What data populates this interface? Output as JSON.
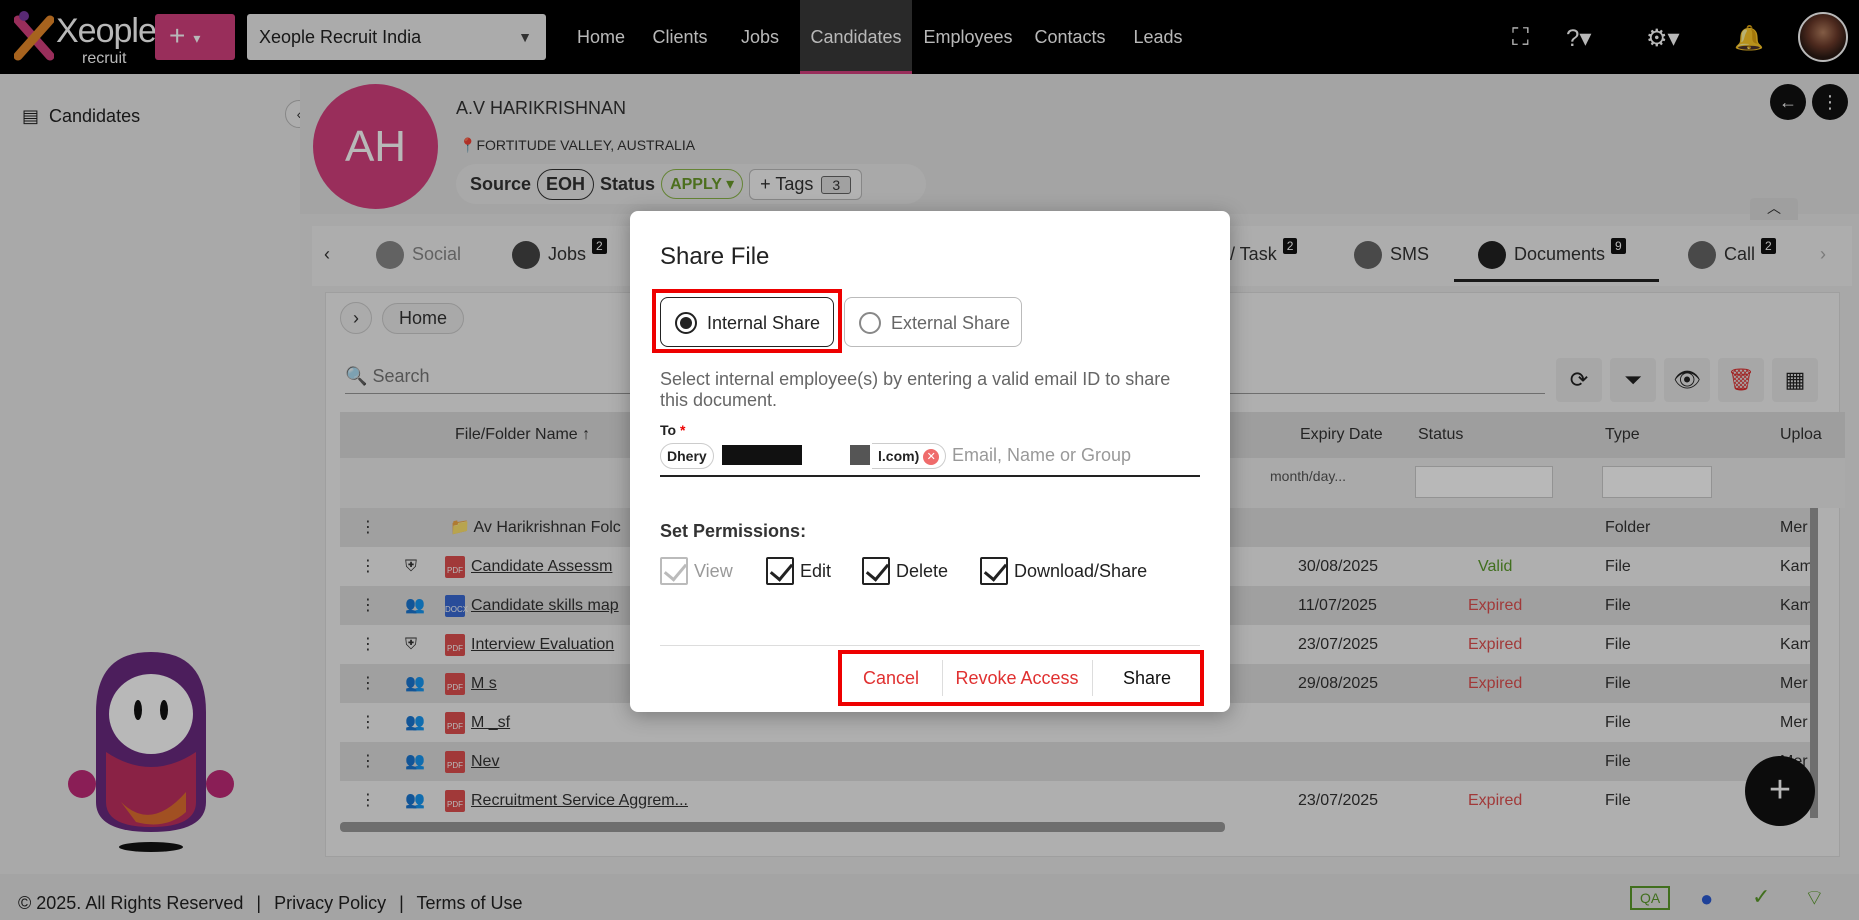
{
  "topbar": {
    "logo_text": "Xeople",
    "logo_sub": "recruit",
    "add_label": "+",
    "org_select": "Xeople Recruit India",
    "nav": [
      "Home",
      "Clients",
      "Jobs",
      "Candidates",
      "Employees",
      "Contacts",
      "Leads"
    ],
    "active_nav": "Candidates"
  },
  "sidebar": {
    "item": "Candidates"
  },
  "candidate": {
    "initials": "AH",
    "name": "A.V HARIKRISHNAN",
    "location": "FORTITUDE VALLEY, AUSTRALIA",
    "source_label": "Source",
    "source_value": "EOH",
    "status_label": "Status",
    "status_value": "APPLY",
    "tags_label": "Tags",
    "tags_count": "3"
  },
  "tabs": [
    {
      "label": "Social",
      "badge": ""
    },
    {
      "label": "Jobs",
      "badge": "2"
    },
    {
      "label": "/ Task",
      "badge": "2"
    },
    {
      "label": "SMS",
      "badge": ""
    },
    {
      "label": "Documents",
      "badge": "9"
    },
    {
      "label": "Call",
      "badge": "2"
    }
  ],
  "documents": {
    "breadcrumb_home": "Home",
    "search_placeholder": "Search",
    "columns": [
      "File/Folder Name ↑",
      "Expiry Date",
      "Status",
      "Type",
      "Uploa"
    ],
    "date_filter_placeholder": "month/day...",
    "rows": [
      {
        "name": "Av Harikrishnan Folc",
        "expiry": "",
        "status": "",
        "type": "Folder",
        "uploaded": "Mer",
        "kind": "folder"
      },
      {
        "name": "Candidate Assessm",
        "expiry": "30/08/2025",
        "status": "Valid",
        "type": "File",
        "uploaded": "Kam",
        "kind": "pdf"
      },
      {
        "name": "Candidate skills map",
        "expiry": "11/07/2025",
        "status": "Expired",
        "type": "File",
        "uploaded": "Kam",
        "kind": "docx"
      },
      {
        "name": "Interview Evaluation",
        "expiry": "23/07/2025",
        "status": "Expired",
        "type": "File",
        "uploaded": "Kam",
        "kind": "pdf"
      },
      {
        "name": "M s",
        "expiry": "29/08/2025",
        "status": "Expired",
        "type": "File",
        "uploaded": "Mer",
        "kind": "pdf"
      },
      {
        "name": "M _sf",
        "expiry": "",
        "status": "",
        "type": "File",
        "uploaded": "Mer",
        "kind": "pdf"
      },
      {
        "name": "Nev",
        "expiry": "",
        "status": "",
        "type": "File",
        "uploaded": "Mer",
        "kind": "pdf"
      },
      {
        "name": "Recruitment Service Aggrem...",
        "expiry": "23/07/2025",
        "status": "Expired",
        "type": "File",
        "uploaded": "",
        "kind": "pdf"
      }
    ]
  },
  "footer": {
    "copyright": "© 2025. All Rights Reserved",
    "privacy": "Privacy Policy",
    "terms": "Terms of Use",
    "env_badge": "QA"
  },
  "modal": {
    "title": "Share File",
    "internal_share": "Internal Share",
    "external_share": "External Share",
    "hint": "Select internal employee(s) by entering a valid email ID to share this document.",
    "to_label": "To",
    "chip_start": "Dhery",
    "chip_end": "l.com)",
    "to_placeholder": "Email, Name or Group",
    "permissions_label": "Set Permissions:",
    "permissions": [
      "View",
      "Edit",
      "Delete",
      "Download/Share"
    ],
    "cancel": "Cancel",
    "revoke": "Revoke Access",
    "share": "Share"
  },
  "colors": {
    "accent": "#d4407f",
    "danger": "#e03030",
    "valid": "#5a9a2a"
  }
}
